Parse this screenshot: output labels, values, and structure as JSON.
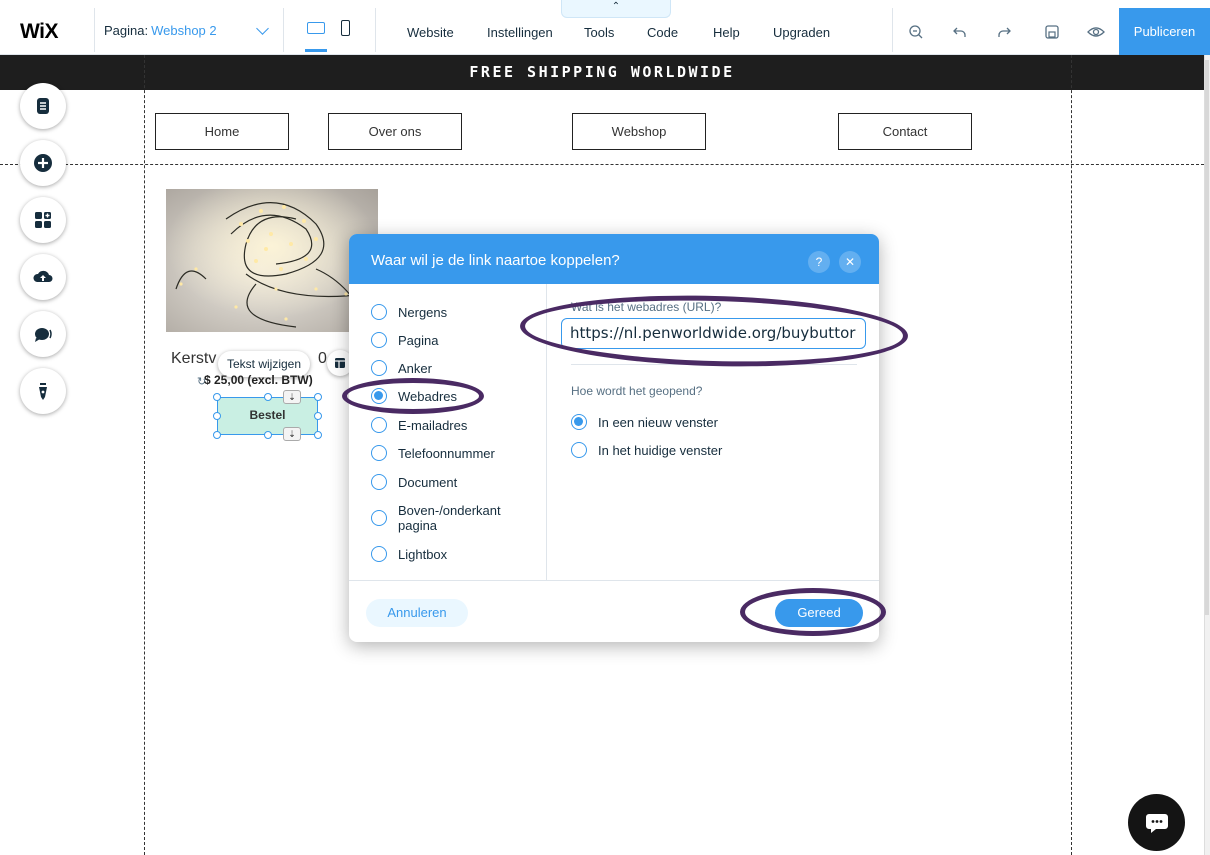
{
  "topbar": {
    "logo": "WiX",
    "page_label": "Pagina:",
    "page_name": "Webshop 2",
    "menu": [
      "Website",
      "Instellingen",
      "Tools",
      "Code",
      "Help",
      "Upgraden"
    ],
    "pull_tab_glyph": "⌃",
    "publish_label": "Publiceren",
    "accent_color": "#3899ec"
  },
  "site": {
    "banner": "FREE SHIPPING WORLDWIDE",
    "nav": [
      "Home",
      "Over ons",
      "Webshop",
      "Contact"
    ],
    "product": {
      "title_start": "Kerstv",
      "title_end": "0",
      "tooltip": "Tekst wijzigen",
      "price": "$ 25,00 (excl. BTW)",
      "button": "Bestel"
    }
  },
  "rail_icons": [
    "pages-icon",
    "add-icon",
    "apps-icon",
    "upload-icon",
    "chat-bubble-icon",
    "pen-icon"
  ],
  "dialog": {
    "title": "Waar wil je de link naartoe koppelen?",
    "help": "?",
    "close": "✕",
    "options": [
      "Nergens",
      "Pagina",
      "Anker",
      "Webadres",
      "E-mailadres",
      "Telefoonnummer",
      "Document",
      "Boven-/onderkant pagina",
      "Lightbox"
    ],
    "selected_option": "Webadres",
    "url_label": "Wat is het webadres (URL)?",
    "url_value": "https://nl.penworldwide.org/buybuttor",
    "open_label": "Hoe wordt het geopend?",
    "open_options": [
      "In een nieuw venster",
      "In het huidige venster"
    ],
    "open_selected": "In een nieuw venster",
    "cancel": "Annuleren",
    "done": "Gereed"
  },
  "annotation_color": "#4a2a63"
}
